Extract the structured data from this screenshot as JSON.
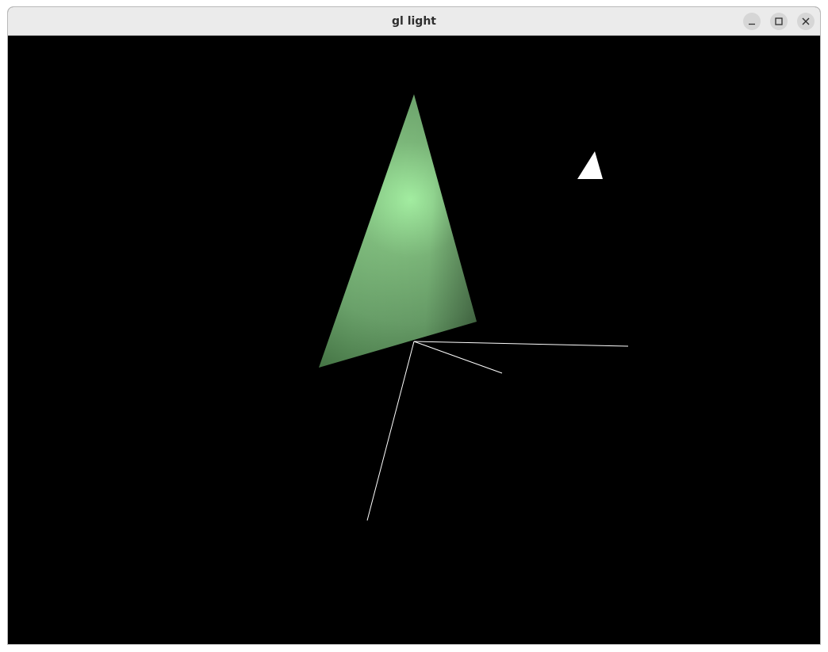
{
  "window": {
    "title": "gl light"
  },
  "colors": {
    "titlebar_bg": "#ebebeb",
    "title_text": "#2e2e2e",
    "viewport_bg": "#000000",
    "triangle_light": "#a8f5a6",
    "triangle_mid": "#6aa16a",
    "triangle_dark": "#3c6a3c",
    "axis_lines": "#ffffff",
    "light_marker": "#ffffff"
  },
  "icons": {
    "minimize": "minimize-icon",
    "maximize": "maximize-icon",
    "close": "close-icon"
  }
}
